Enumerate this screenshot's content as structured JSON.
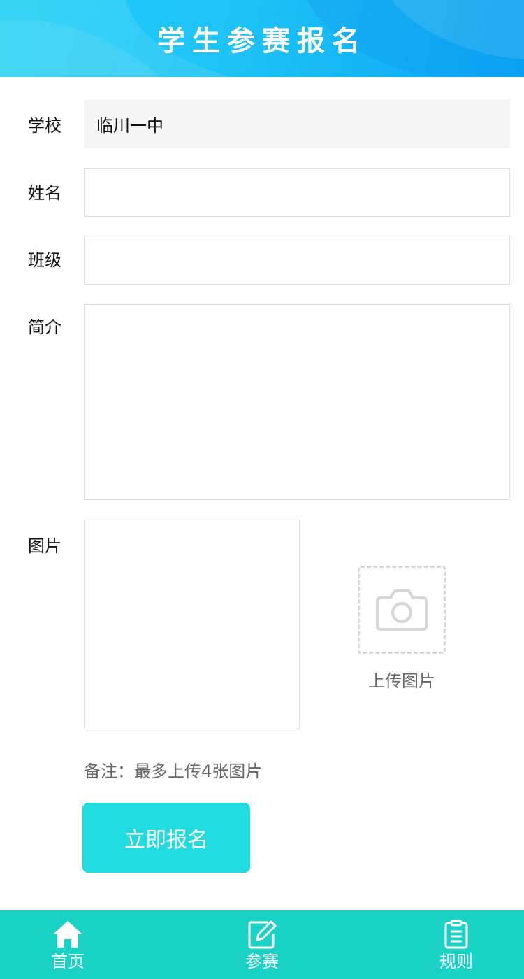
{
  "header": {
    "title": "学生参赛报名"
  },
  "form": {
    "school": {
      "label": "学校",
      "value": "临川一中"
    },
    "name": {
      "label": "姓名",
      "value": "",
      "placeholder": ""
    },
    "class": {
      "label": "班级",
      "value": "",
      "placeholder": ""
    },
    "intro": {
      "label": "简介",
      "value": "",
      "placeholder": ""
    },
    "image": {
      "label": "图片",
      "upload_label": "上传图片",
      "upload_icon": "camera-icon"
    },
    "note": "备注：最多上传4张图片",
    "submit_label": "立即报名"
  },
  "tabbar": {
    "items": [
      {
        "label": "首页",
        "icon": "home-icon"
      },
      {
        "label": "参赛",
        "icon": "edit-icon"
      },
      {
        "label": "规则",
        "icon": "document-icon"
      }
    ]
  },
  "colors": {
    "header_gradient_start": "#1fd0f4",
    "header_gradient_end": "#0aa6f5",
    "button": "#22dbe0",
    "tabbar": "#1ad1c5"
  }
}
